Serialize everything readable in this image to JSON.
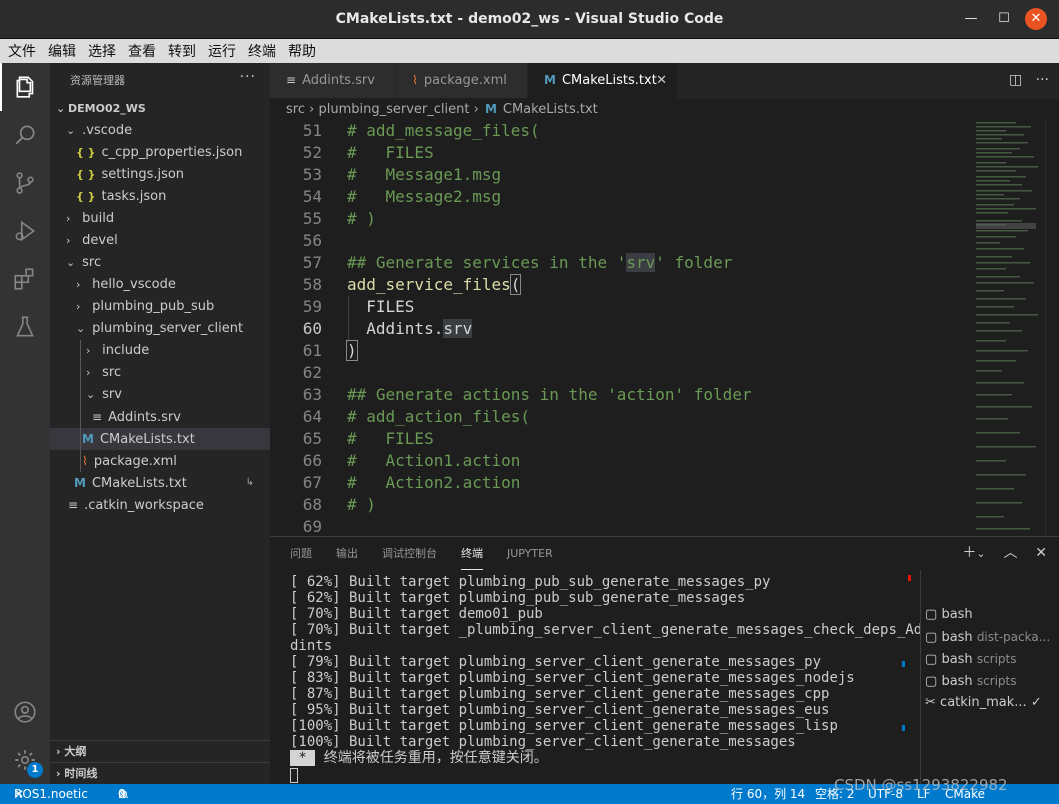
{
  "window": {
    "title": "CMakeLists.txt - demo02_ws - Visual Studio Code"
  },
  "menu": [
    "文件",
    "编辑",
    "选择",
    "查看",
    "转到",
    "运行",
    "终端",
    "帮助"
  ],
  "activity": {
    "badge": "1"
  },
  "sidebar": {
    "header": "资源管理器",
    "more": "···",
    "root": "DEMO02_WS",
    "items": [
      {
        "label": ".vscode",
        "type": "folder-open"
      },
      {
        "label": "c_cpp_properties.json",
        "type": "json"
      },
      {
        "label": "settings.json",
        "type": "json"
      },
      {
        "label": "tasks.json",
        "type": "json"
      },
      {
        "label": "build",
        "type": "folder"
      },
      {
        "label": "devel",
        "type": "folder"
      },
      {
        "label": "src",
        "type": "folder-open"
      },
      {
        "label": "hello_vscode",
        "type": "folder"
      },
      {
        "label": "plumbing_pub_sub",
        "type": "folder"
      },
      {
        "label": "plumbing_server_client",
        "type": "folder-open"
      },
      {
        "label": "include",
        "type": "folder"
      },
      {
        "label": "src",
        "type": "folder"
      },
      {
        "label": "srv",
        "type": "folder-open"
      },
      {
        "label": "Addints.srv",
        "type": "srv"
      },
      {
        "label": "CMakeLists.txt",
        "type": "cmake"
      },
      {
        "label": "package.xml",
        "type": "xml"
      },
      {
        "label": "CMakeLists.txt",
        "type": "cmake"
      },
      {
        "label": ".catkin_workspace",
        "type": "text"
      }
    ],
    "outline": "大纲",
    "timeline": "时间线"
  },
  "tabs": [
    {
      "label": "Addints.srv"
    },
    {
      "label": "package.xml"
    },
    {
      "label": "CMakeLists.txt",
      "close": "✕"
    }
  ],
  "breadcrumb": {
    "part1": "src",
    "sep": "›",
    "part2": "plumbing_server_client",
    "file": "CMakeLists.txt"
  },
  "editor": {
    "lines": [
      {
        "n": "51",
        "t": "# add_message_files("
      },
      {
        "n": "52",
        "t": "#   FILES"
      },
      {
        "n": "53",
        "t": "#   Message1.msg"
      },
      {
        "n": "54",
        "t": "#   Message2.msg"
      },
      {
        "n": "55",
        "t": "# )"
      },
      {
        "n": "56",
        "t": ""
      },
      {
        "n": "57",
        "t_a": "## Generate services in the '",
        "t_b": "srv",
        "t_c": "' folder"
      },
      {
        "n": "58",
        "t_a": "add_service_files",
        "t_b": "("
      },
      {
        "n": "59",
        "t": "  FILES"
      },
      {
        "n": "60",
        "t_a": "  Addints.",
        "t_b": "srv"
      },
      {
        "n": "61",
        "t": ")"
      },
      {
        "n": "62",
        "t": ""
      },
      {
        "n": "63",
        "t": "## Generate actions in the 'action' folder"
      },
      {
        "n": "64",
        "t": "# add_action_files("
      },
      {
        "n": "65",
        "t": "#   FILES"
      },
      {
        "n": "66",
        "t": "#   Action1.action"
      },
      {
        "n": "67",
        "t": "#   Action2.action"
      },
      {
        "n": "68",
        "t": "# )"
      },
      {
        "n": "69",
        "t": ""
      }
    ]
  },
  "panel": {
    "tabs": [
      "问题",
      "输出",
      "调试控制台",
      "终端",
      "JUPYTER"
    ],
    "active_tab": "终端",
    "terminal_lines": [
      "[ 62%] Built target plumbing_pub_sub_generate_messages_py",
      "[ 62%] Built target plumbing_pub_sub_generate_messages",
      "[ 70%] Built target demo01_pub",
      "[ 70%] Built target _plumbing_server_client_generate_messages_check_deps_Ad",
      "dints",
      "[ 79%] Built target plumbing_server_client_generate_messages_py",
      "[ 83%] Built target plumbing_server_client_generate_messages_nodejs",
      "[ 87%] Built target plumbing_server_client_generate_messages_cpp",
      "[ 95%] Built target plumbing_server_client_generate_messages_eus",
      "[100%] Built target plumbing_server_client_generate_messages_lisp",
      "[100%] Built target plumbing_server_client_generate_messages"
    ],
    "reuse_star": " * ",
    "reuse_msg": " 终端将被任务重用，按任意键关闭。",
    "terminals": [
      {
        "name": "bash",
        "detail": ""
      },
      {
        "name": "bash",
        "detail": "dist-packa..."
      },
      {
        "name": "bash",
        "detail": "scripts"
      },
      {
        "name": "bash",
        "detail": "scripts"
      },
      {
        "name": "catkin_mak...",
        "detail": "",
        "check": "✓"
      }
    ]
  },
  "status": {
    "remote": "ROS1.noetic",
    "errors": "0",
    "warnings": "0",
    "position": "行 60，列 14",
    "spaces": "空格: 2",
    "encoding": "UTF-8",
    "eol": "LF",
    "language": "CMake"
  },
  "watermark": "CSDN @ss1293822982",
  "colors": {
    "accent": "#007acc",
    "remote": "#16825d",
    "close": "#e95420",
    "comment": "#6a9955",
    "function": "#dcdcaa"
  }
}
